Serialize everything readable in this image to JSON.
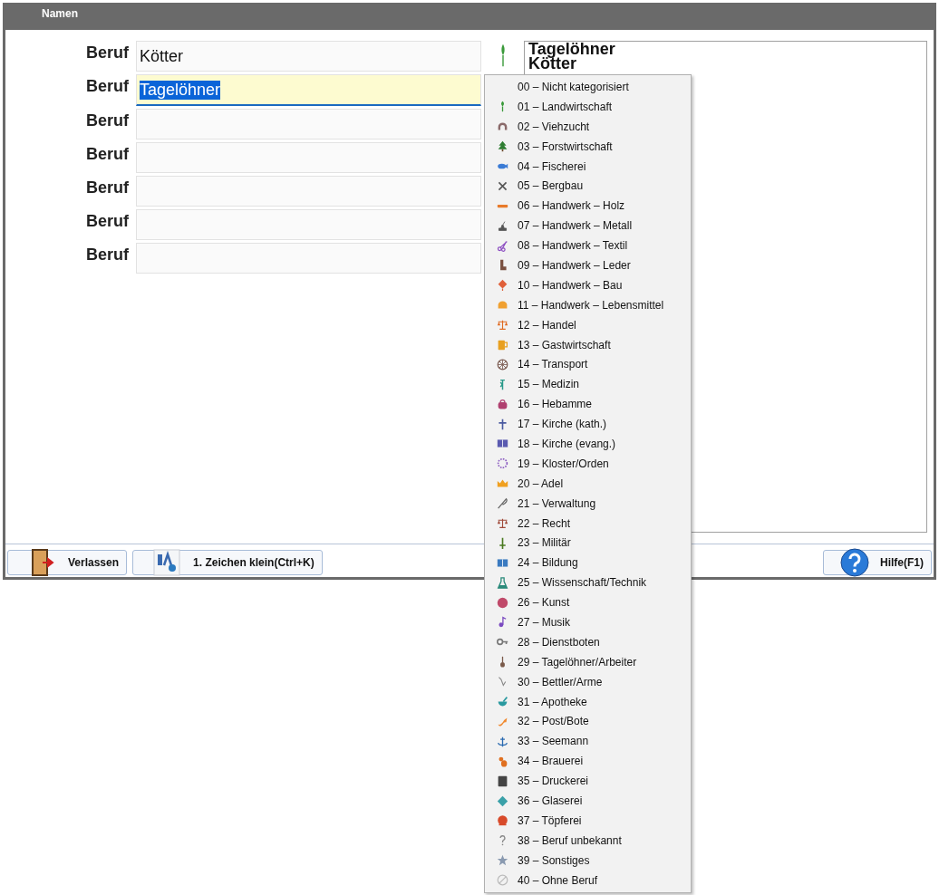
{
  "window": {
    "title": "Namen"
  },
  "fields": [
    {
      "label": "Beruf",
      "value": "Kötter",
      "selected": false
    },
    {
      "label": "Beruf",
      "value": "Tagelöhner",
      "selected": true
    },
    {
      "label": "Beruf",
      "selected": false
    },
    {
      "label": "Beruf",
      "selected": false
    },
    {
      "label": "Beruf",
      "selected": false
    },
    {
      "label": "Beruf",
      "selected": false
    },
    {
      "label": "Beruf",
      "selected": false
    }
  ],
  "preview": {
    "lines": [
      "Tagelöhner",
      "Kötter"
    ]
  },
  "dropdown": {
    "items": [
      "00 – Nicht kategorisiert",
      "01 – Landwirtschaft",
      "02 – Viehzucht",
      "03 – Forstwirtschaft",
      "04 – Fischerei",
      "05 – Bergbau",
      "06 – Handwerk – Holz",
      "07 – Handwerk – Metall",
      "08 – Handwerk – Textil",
      "09 – Handwerk – Leder",
      "10 – Handwerk – Bau",
      "11 – Handwerk – Lebensmittel",
      "12 – Handel",
      "13 – Gastwirtschaft",
      "14 – Transport",
      "15 – Medizin",
      "16 – Hebamme",
      "17 – Kirche (kath.)",
      "18 – Kirche (evang.)",
      "19 – Kloster/Orden",
      "20 – Adel",
      "21 – Verwaltung",
      "22 – Recht",
      "23 – Militär",
      "24 – Bildung",
      "25 – Wissenschaft/Technik",
      "26 – Kunst",
      "27 – Musik",
      "28 – Dienstboten",
      "29 – Tagelöhner/Arbeiter",
      "30 – Bettler/Arme",
      "31 – Apotheke",
      "32 – Post/Bote",
      "33 – Seemann",
      "34 – Brauerei",
      "35 – Druckerei",
      "36 – Glaserei",
      "37 – Töpferei",
      "38 – Beruf unbekannt",
      "39 – Sonstiges",
      "40 – Ohne Beruf"
    ]
  },
  "buttons": [
    {
      "label": "Verlassen",
      "kind": "exit"
    },
    {
      "label": "1. Zeichen klein(Ctrl+K)",
      "kind": "case"
    },
    {
      "label": "Hilfe(F1)",
      "kind": "help"
    }
  ]
}
